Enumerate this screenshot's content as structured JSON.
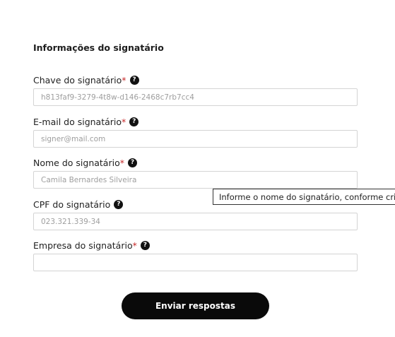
{
  "section": {
    "title": "Informações do signatário"
  },
  "fields": [
    {
      "label": "Chave do signatário",
      "required": "*",
      "value": "h813faf9-3279-4t8w-d146-2468c7rb7cc4"
    },
    {
      "label": "E-mail do signatário",
      "required": "*",
      "value": "signer@mail.com"
    },
    {
      "label": "Nome do signatário",
      "required": "*",
      "value": "Camila Bernardes Silveira"
    },
    {
      "label": "CPF do signatário",
      "required": "",
      "value": "023.321.339-34"
    },
    {
      "label": "Empresa do signatário",
      "required": "*",
      "value": ""
    }
  ],
  "help_glyph": "?",
  "tooltip": {
    "text": "Informe o nome do signatário, conforme criação"
  },
  "submit": {
    "label": "Enviar respostas"
  },
  "colors": {
    "required": "#c62828",
    "button": "#0a0a0a",
    "border": "#d4d4d4"
  }
}
